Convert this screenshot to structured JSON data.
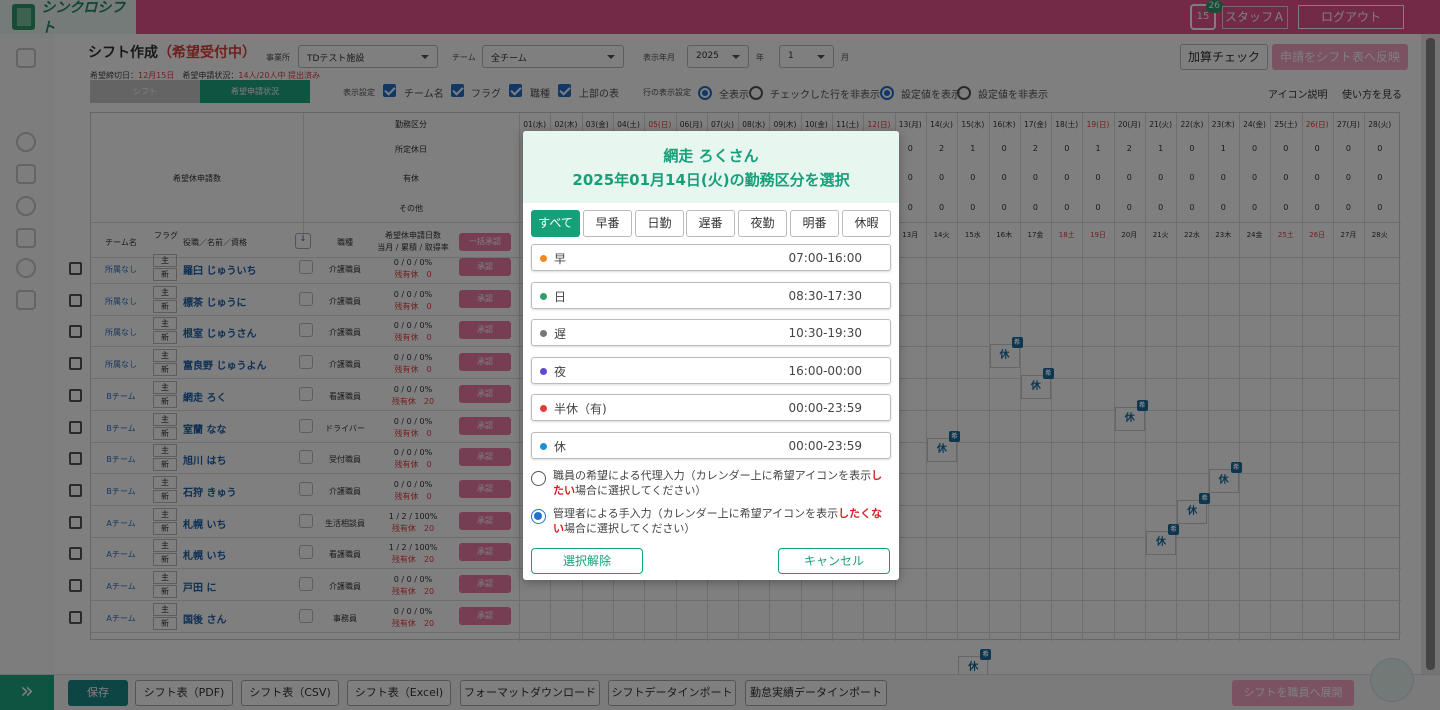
{
  "header": {
    "logo": "シンクロシフト",
    "calendar_icon_text": "15",
    "notification_count": "26",
    "user": "スタッフＡ",
    "logout": "ログアウト"
  },
  "page": {
    "title": "シフト作成",
    "status": "（希望受付中）"
  },
  "filters": {
    "office_label": "事業所",
    "office_value": "TDテスト施設",
    "team_label": "チーム",
    "team_value": "全チーム",
    "period_label": "表示年月",
    "year": "2025",
    "year_unit": "年",
    "month": "1",
    "month_unit": "月"
  },
  "actions": {
    "add_check": "加算チェック",
    "reflect": "申請をシフト表へ反映"
  },
  "info": {
    "deadline_label": "希望締切日：",
    "deadline": "12月15日",
    "status_label": "希望申請状況：",
    "status": "14人/20人中 提出済み"
  },
  "tabs": [
    "シフト",
    "希望申請状況"
  ],
  "display": {
    "label": "表示設定",
    "options": [
      "チーム名",
      "フラグ",
      "職種",
      "上部の表"
    ]
  },
  "rowdisplay": {
    "label": "行の表示設定",
    "options": [
      "全表示",
      "チェックした行を非表示",
      "設定値を表示",
      "設定値を非表示"
    ]
  },
  "help": {
    "icon_help": "アイコン説明",
    "howto": "使い方を見る"
  },
  "grid": {
    "summary_label": "希望休申請数",
    "summary_rows": [
      "勤務区分",
      "所定休日",
      "有休",
      "その他"
    ],
    "day_headers": [
      "01(水)",
      "02(木)",
      "03(金)",
      "04(土)",
      "05(日)",
      "06(月)",
      "07(火)",
      "08(水)",
      "09(木)",
      "10(金)",
      "11(土)",
      "12(日)",
      "13(月)",
      "14(火)",
      "15(水)",
      "16(木)",
      "17(金)",
      "18(土)",
      "19(日)",
      "20(月)",
      "21(火)",
      "22(水)",
      "23(木)",
      "24(金)",
      "25(土)",
      "26(日)",
      "27(月)",
      "28(火)"
    ],
    "visible_counts_shoteikyu": [
      "0",
      "2",
      "1",
      "0",
      "2",
      "0",
      "1",
      "2",
      "1",
      "0",
      "1",
      "0",
      "0",
      "0",
      "0",
      "0"
    ],
    "visible_counts_zero": "0",
    "col_headers": {
      "team": "チーム名",
      "flag": "フラグ",
      "name": "役職／名前／資格",
      "job": "職種",
      "req": "希望休申請日数",
      "req_sub": "当月 / 累積 / 取得率",
      "bulk": "一括承認"
    },
    "day_short": [
      "13月",
      "14火",
      "15水",
      "16木",
      "17金",
      "18土",
      "19日",
      "20月",
      "21火",
      "22水",
      "23木",
      "24金",
      "25土",
      "26日",
      "27月",
      "28火"
    ],
    "rows": [
      {
        "team": "所属なし",
        "name": "羅臼 じゅういち",
        "job": "介護職員",
        "req": "0 / 0 / 0%",
        "rest": "残有休　0"
      },
      {
        "team": "所属なし",
        "name": "標茶 じゅうに",
        "job": "介護職員",
        "req": "0 / 0 / 0%",
        "rest": "残有休　0"
      },
      {
        "team": "所属なし",
        "name": "根室 じゅうさん",
        "job": "介護職員",
        "req": "0 / 0 / 0%",
        "rest": "残有休　0"
      },
      {
        "team": "所属なし",
        "name": "富良野 じゅうよん",
        "job": "介護職員",
        "req": "0 / 0 / 0%",
        "rest": "残有休　0"
      },
      {
        "team": "Bチーム",
        "name": "網走 ろく",
        "job": "看護職員",
        "req": "0 / 0 / 0%",
        "rest": "残有休　20"
      },
      {
        "team": "Bチーム",
        "name": "室蘭 なな",
        "job": "ドライバー",
        "req": "0 / 0 / 0%",
        "rest": "残有休　0"
      },
      {
        "team": "Bチーム",
        "name": "旭川 はち",
        "job": "受付職員",
        "req": "0 / 0 / 0%",
        "rest": "残有休　0"
      },
      {
        "team": "Bチーム",
        "name": "石狩 きゅう",
        "job": "介護職員",
        "req": "0 / 0 / 0%",
        "rest": "残有休　0"
      },
      {
        "team": "Aチーム",
        "name": "札幌 いち",
        "job": "生活相談員",
        "req": "1 / 2 / 100%",
        "rest": "残有休　20"
      },
      {
        "team": "Aチーム",
        "name": "札幌 いち",
        "job": "看護職員",
        "req": "1 / 2 / 100%",
        "rest": "残有休　20"
      },
      {
        "team": "Aチーム",
        "name": "戸田 に",
        "job": "介護職員",
        "req": "0 / 0 / 0%",
        "rest": "残有休　20"
      },
      {
        "team": "Aチーム",
        "name": "国後 さん",
        "job": "事務員",
        "req": "0 / 0 / 0%",
        "rest": "残有休　20"
      }
    ],
    "flag_main": "主",
    "flag_new": "新",
    "approve": "承認",
    "holiday_mark": "休",
    "hope_mark": "希"
  },
  "footer": {
    "save": "保存",
    "pdf": "シフト表（PDF)",
    "csv": "シフト表（CSV)",
    "excel": "シフト表（Excel)",
    "format_dl": "フォーマットダウンロード",
    "shift_import": "シフトデータインポート",
    "actual_import": "勤怠実績データインポート",
    "deploy": "シフトを職員へ展開"
  },
  "modal": {
    "title_name": "網走 ろくさん",
    "title_date": "2025年01月14日(火)の勤務区分を選択",
    "tabs": [
      "すべて",
      "早番",
      "日勤",
      "遅番",
      "夜勤",
      "明番",
      "休暇"
    ],
    "options": [
      {
        "name": "早",
        "time": "07:00-16:00",
        "color": "#f08a1c"
      },
      {
        "name": "日",
        "time": "08:30-17:30",
        "color": "#2e9e6a"
      },
      {
        "name": "遅",
        "time": "10:30-19:30",
        "color": "#777777"
      },
      {
        "name": "夜",
        "time": "16:00-00:00",
        "color": "#5a4bd1"
      },
      {
        "name": "半休（有)",
        "time": "00:00-23:59",
        "color": "#e23d3d"
      },
      {
        "name": "休",
        "time": "00:00-23:59",
        "color": "#1f8fd0"
      }
    ],
    "radio1_a": "職員の希望による代理入力（カレンダー上に希望アイコンを表示",
    "radio1_em": "したい",
    "radio1_b": "場合に選択してください）",
    "radio2_a": "管理者による手入力（カレンダー上に希望アイコンを表示",
    "radio2_em": "したくない",
    "radio2_b": "場合に選択してください）",
    "clear": "選択解除",
    "cancel": "キャンセル"
  }
}
